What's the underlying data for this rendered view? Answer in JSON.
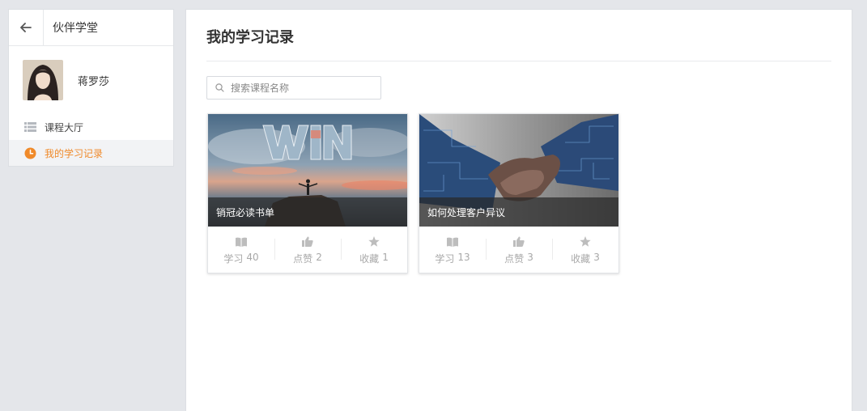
{
  "sidebar": {
    "title": "伙伴学堂",
    "username": "蒋罗莎",
    "nav": [
      {
        "label": "课程大厅",
        "icon": "list-icon"
      },
      {
        "label": "我的学习记录",
        "icon": "clock-icon"
      }
    ]
  },
  "main": {
    "title": "我的学习记录",
    "search": {
      "placeholder": "搜索课程名称",
      "value": ""
    },
    "courses": [
      {
        "name": "销冠必读书单",
        "stats": [
          {
            "label": "学习",
            "count": "40",
            "icon": "book-icon"
          },
          {
            "label": "点赞",
            "count": "2",
            "icon": "thumbs-up-icon"
          },
          {
            "label": "收藏",
            "count": "1",
            "icon": "star-icon"
          }
        ]
      },
      {
        "name": "如何处理客户异议",
        "stats": [
          {
            "label": "学习",
            "count": "13",
            "icon": "book-icon"
          },
          {
            "label": "点赞",
            "count": "3",
            "icon": "thumbs-up-icon"
          },
          {
            "label": "收藏",
            "count": "3",
            "icon": "star-icon"
          }
        ]
      }
    ]
  },
  "colors": {
    "accent": "#f08a2a",
    "background": "#e4e6ea",
    "stat_text": "#a8a8a8"
  }
}
